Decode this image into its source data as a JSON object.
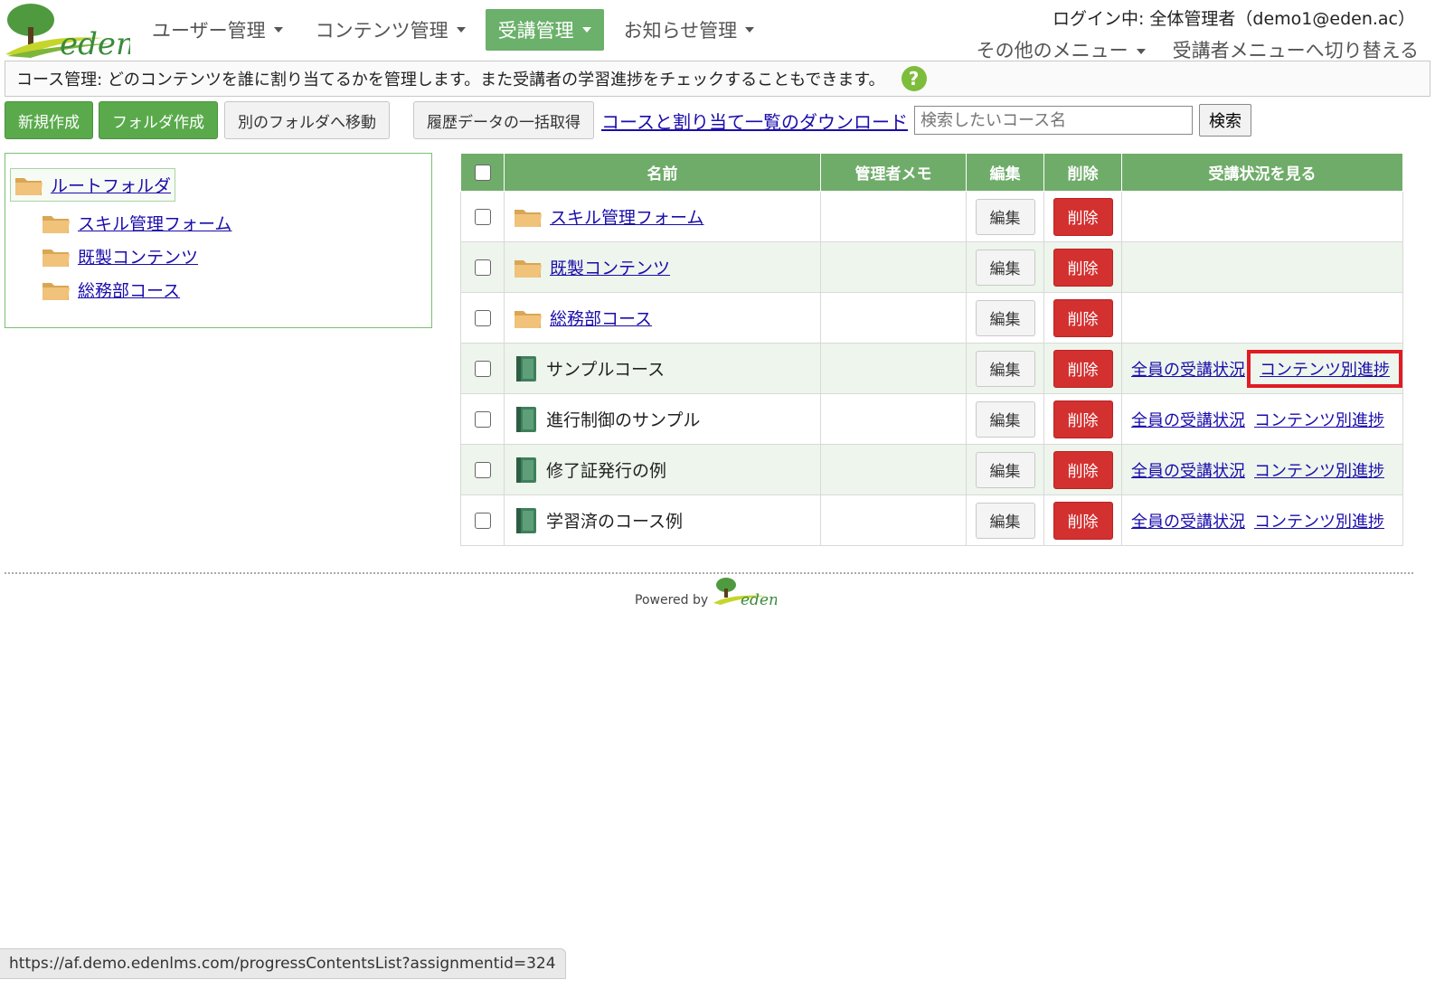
{
  "logo": {
    "text": "eden"
  },
  "nav": {
    "items": [
      {
        "label": "ユーザー管理",
        "active": false
      },
      {
        "label": "コンテンツ管理",
        "active": false
      },
      {
        "label": "受講管理",
        "active": true
      },
      {
        "label": "お知らせ管理",
        "active": false
      }
    ]
  },
  "header": {
    "login_text": "ログイン中: 全体管理者（demo1@eden.ac）",
    "other_menu": "その他のメニュー",
    "switch_menu": "受講者メニューへ切り替える"
  },
  "description": {
    "text": "コース管理: どのコンテンツを誰に割り当てるかを管理します。また受講者の学習進捗をチェックすることもできます。",
    "help": "?"
  },
  "toolbar": {
    "new_label": "新規作成",
    "folder_label": "フォルダ作成",
    "move_label": "別のフォルダへ移動",
    "history_label": "履歴データの一括取得",
    "download_label": "コースと割り当て一覧のダウンロード",
    "search_placeholder": "検索したいコース名",
    "search_label": "検索"
  },
  "tree": {
    "root": "ルートフォルダ",
    "children": [
      "スキル管理フォーム",
      "既製コンテンツ",
      "総務部コース"
    ]
  },
  "table": {
    "headers": {
      "name": "名前",
      "memo": "管理者メモ",
      "edit": "編集",
      "delete": "削除",
      "status": "受講状況を見る"
    },
    "edit_label": "編集",
    "delete_label": "削除",
    "status_all": "全員の受講状況",
    "status_content": "コンテンツ別進捗",
    "rows": [
      {
        "name": "スキル管理フォーム",
        "type": "folder"
      },
      {
        "name": "既製コンテンツ",
        "type": "folder"
      },
      {
        "name": "総務部コース",
        "type": "folder"
      },
      {
        "name": "サンプルコース",
        "type": "course"
      },
      {
        "name": "進行制御のサンプル",
        "type": "course"
      },
      {
        "name": "修了証発行の例",
        "type": "course"
      },
      {
        "name": "学習済のコース例",
        "type": "course"
      }
    ]
  },
  "footer": {
    "powered_by": "Powered by",
    "logo_text": "eden"
  },
  "statusbar": {
    "url": "https://af.demo.edenlms.com/progressContentsList?assignmentid=324"
  },
  "colors": {
    "accent_green": "#6bb06b",
    "delete_red": "#d33030",
    "highlight_red": "#e01b24",
    "link_blue": "#1a0dab"
  }
}
